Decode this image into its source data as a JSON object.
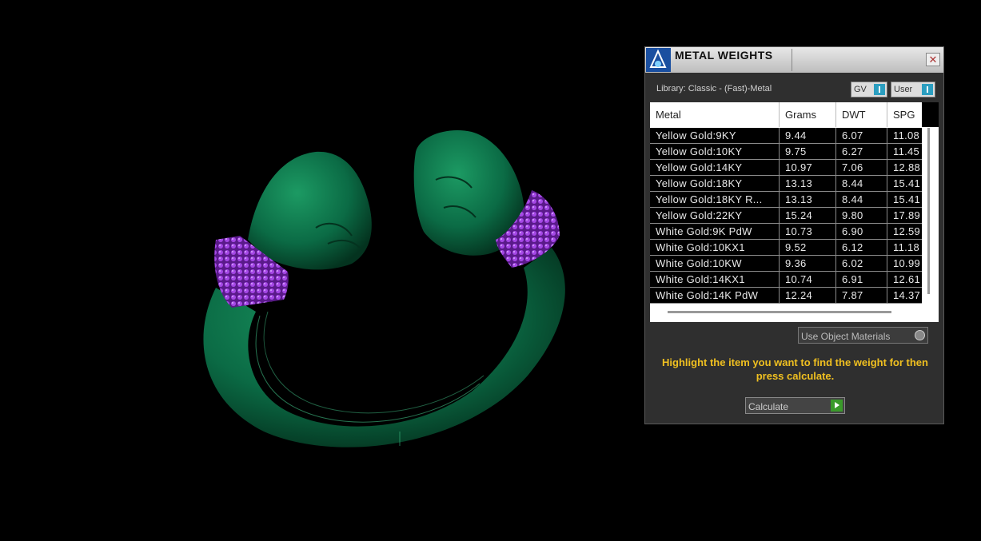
{
  "panel": {
    "title": "METAL WEIGHTS",
    "close_label": "x",
    "library_label": "Library: Classic - (Fast)-Metal",
    "toggle_gv": "GV",
    "toggle_user": "User",
    "columns": [
      "Metal",
      "Grams",
      "DWT",
      "SPG"
    ],
    "rows": [
      {
        "metal": "Yellow Gold:9KY",
        "grams": "9.44",
        "dwt": "6.07",
        "spg": "11.08"
      },
      {
        "metal": "Yellow Gold:10KY",
        "grams": "9.75",
        "dwt": "6.27",
        "spg": "11.45"
      },
      {
        "metal": "Yellow Gold:14KY",
        "grams": "10.97",
        "dwt": "7.06",
        "spg": "12.88"
      },
      {
        "metal": "Yellow Gold:18KY",
        "grams": "13.13",
        "dwt": "8.44",
        "spg": "15.41"
      },
      {
        "metal": "Yellow Gold:18KY R...",
        "grams": "13.13",
        "dwt": "8.44",
        "spg": "15.41"
      },
      {
        "metal": "Yellow Gold:22KY",
        "grams": "15.24",
        "dwt": "9.80",
        "spg": "17.89"
      },
      {
        "metal": "White Gold:9K PdW",
        "grams": "10.73",
        "dwt": "6.90",
        "spg": "12.59"
      },
      {
        "metal": "White Gold:10KX1",
        "grams": "9.52",
        "dwt": "6.12",
        "spg": "11.18"
      },
      {
        "metal": "White Gold:10KW",
        "grams": "9.36",
        "dwt": "6.02",
        "spg": "10.99"
      },
      {
        "metal": "White Gold:14KX1",
        "grams": "10.74",
        "dwt": "6.91",
        "spg": "12.61"
      },
      {
        "metal": "White Gold:14K PdW",
        "grams": "12.24",
        "dwt": "7.87",
        "spg": "14.37"
      }
    ],
    "use_object_materials": "Use Object Materials",
    "instruction": "Highlight the item you want to find the weight for then press calculate.",
    "calculate_label": "Calculate"
  },
  "colors": {
    "ring_green": "#0b6b45",
    "cuff_purple": "#8a2fc9",
    "instruction_yellow": "#f0c020",
    "toggle_accent": "#2b9ec0",
    "calc_green": "#3a9a2a"
  },
  "icons": {
    "logo": "app-logo-icon",
    "close": "close-icon",
    "toggle": "toggle-switch-icon",
    "dropdown": "dropdown-circle-icon",
    "play": "play-arrow-icon"
  }
}
